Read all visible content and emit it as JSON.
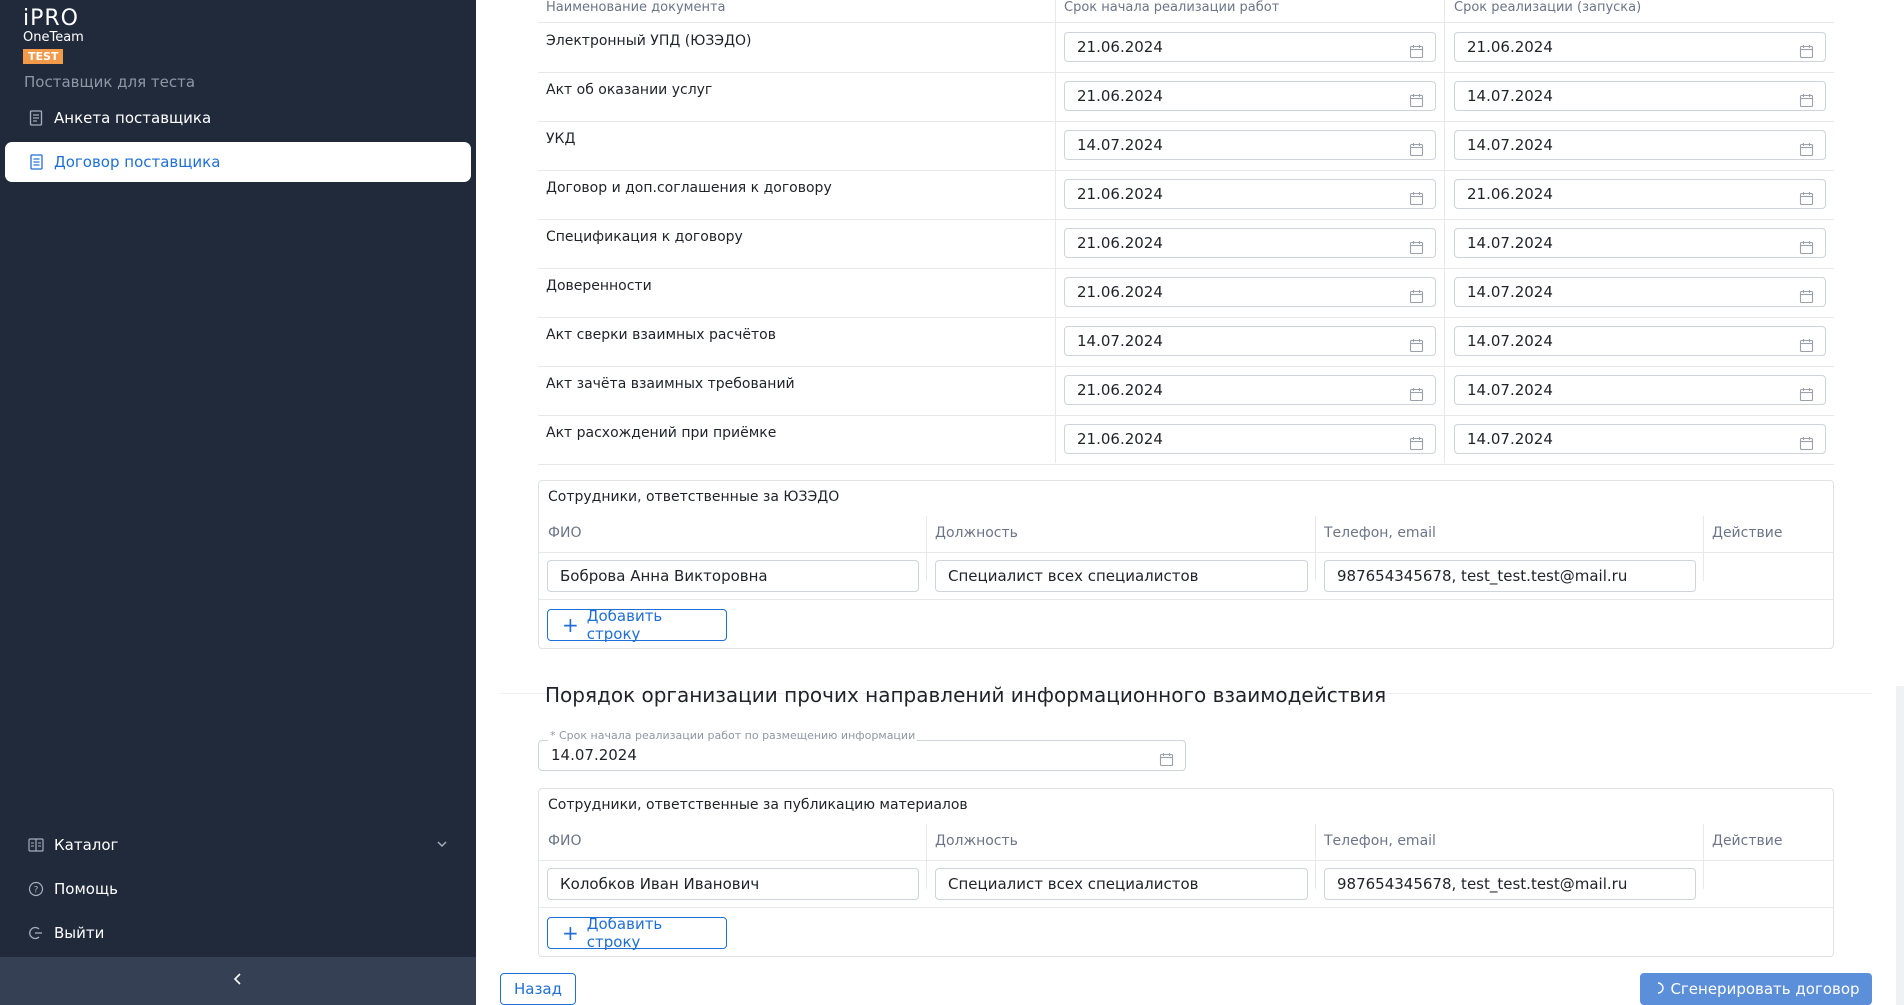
{
  "sidebar": {
    "logo_line1": "iPRO",
    "logo_line2": "OneTeam",
    "logo_badge": "TEST",
    "supplier": "Поставщик для теста",
    "items": [
      {
        "label": "Анкета поставщика",
        "icon": "document-list-icon"
      },
      {
        "label": "Договор поставщика",
        "icon": "document-icon",
        "active": true
      }
    ],
    "bottom_items": [
      {
        "label": "Каталог",
        "icon": "catalog-icon"
      },
      {
        "label": "Помощь",
        "icon": "help-icon"
      },
      {
        "label": "Выйти",
        "icon": "logout-icon"
      }
    ]
  },
  "doc_table": {
    "headers": [
      "Наименование документа",
      "Срок начала реализации работ",
      "Срок реализации (запуска)"
    ],
    "rows": [
      {
        "name": "Электронный УПД (ЮЗЭДО)",
        "start": "21.06.2024",
        "launch": "21.06.2024"
      },
      {
        "name": "Акт об оказании услуг",
        "start": "21.06.2024",
        "launch": "14.07.2024"
      },
      {
        "name": "УКД",
        "start": "14.07.2024",
        "launch": "14.07.2024"
      },
      {
        "name": "Договор и доп.соглашения к договору",
        "start": "21.06.2024",
        "launch": "21.06.2024"
      },
      {
        "name": "Спецификация к договору",
        "start": "21.06.2024",
        "launch": "14.07.2024"
      },
      {
        "name": "Доверенности",
        "start": "21.06.2024",
        "launch": "14.07.2024"
      },
      {
        "name": "Акт сверки взаимных расчётов",
        "start": "14.07.2024",
        "launch": "14.07.2024"
      },
      {
        "name": "Акт зачёта взаимных требований",
        "start": "21.06.2024",
        "launch": "14.07.2024"
      },
      {
        "name": "Акт расхождений при приёмке",
        "start": "21.06.2024",
        "launch": "14.07.2024"
      }
    ]
  },
  "edo_panel": {
    "title": "Сотрудники, ответственные за ЮЗЭДО",
    "columns": [
      "ФИО",
      "Должность",
      "Телефон, email",
      "Действие"
    ],
    "row": {
      "fio": "Боброва Анна Викторовна",
      "position": "Специалист всех специалистов",
      "contact": "987654345678, test_test.test@mail.ru"
    },
    "add_label": "Добавить строку"
  },
  "other_section": {
    "title": "Порядок организации прочих направлений информационного взаимодействия",
    "date_label": "* Срок начала реализации работ по размещению информации",
    "date_value": "14.07.2024"
  },
  "pub_panel": {
    "title": "Сотрудники, ответственные за публикацию материалов",
    "columns": [
      "ФИО",
      "Должность",
      "Телефон, email",
      "Действие"
    ],
    "row": {
      "fio": "Колобков Иван Иванович",
      "position": "Специалист всех специалистов",
      "contact": "987654345678, test_test.test@mail.ru"
    },
    "add_label": "Добавить строку"
  },
  "footer": {
    "back_label": "Назад",
    "generate_label": "Сгенерировать договор"
  }
}
